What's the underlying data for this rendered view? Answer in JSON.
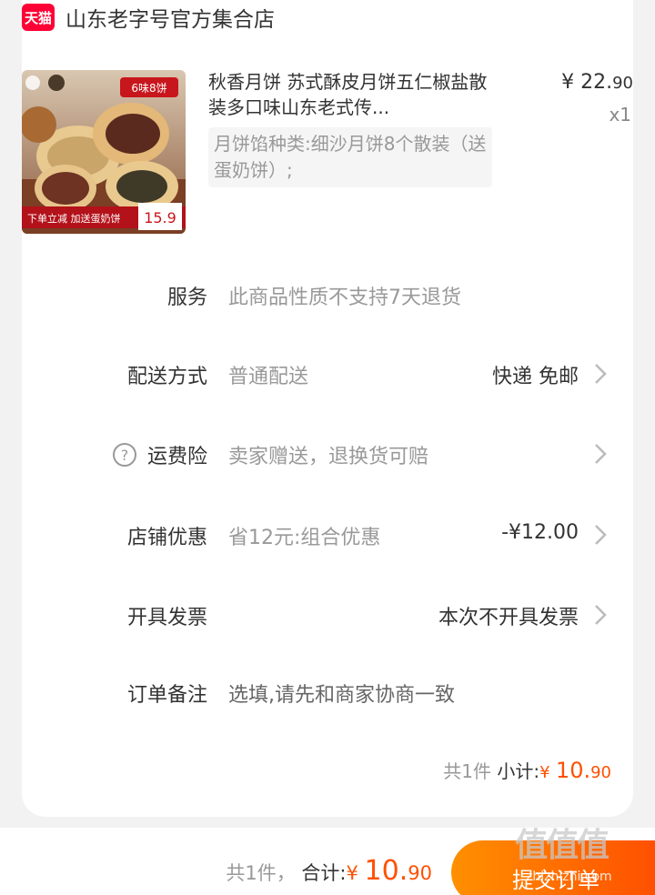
{
  "shop": {
    "badge": "天猫",
    "name": "山东老字号官方集合店"
  },
  "product": {
    "title": "秋香月饼 苏式酥皮月饼五仁椒盐散装多口味山东老式传...",
    "price_symbol": "¥",
    "price_int": "22.",
    "price_dec": "90",
    "qty": "x1",
    "sku": "月饼馅种类:细沙月饼8个散装（送蛋奶饼）;",
    "image": {
      "tag": "6味8饼",
      "promo": "下单立减 加送蛋奶饼",
      "promo_price": "15.9"
    }
  },
  "rows": {
    "service": {
      "label": "服务",
      "value": "此商品性质不支持7天退货"
    },
    "delivery": {
      "label": "配送方式",
      "value": "普通配送",
      "right": "快递 免邮"
    },
    "insurance": {
      "label": "运费险",
      "value": "卖家赠送，退换货可赔"
    },
    "discount": {
      "label": "店铺优惠",
      "value": "省12元:组合优惠",
      "right": "-¥12.00"
    },
    "invoice": {
      "label": "开具发票",
      "right": "本次不开具发票"
    },
    "note": {
      "label": "订单备注",
      "placeholder": "选填,请先和商家协商一致"
    }
  },
  "subtotal": {
    "count": "共1件",
    "label": "小计:",
    "symbol": "¥",
    "int": "10.",
    "dec": "90"
  },
  "bottom": {
    "count": "共1件，",
    "label": "合计:",
    "symbol": "¥",
    "int": "10.",
    "dec": "90",
    "submit": "提交订单"
  },
  "watermark": {
    "text": "值值值",
    "sub": "zhizhizhi.com"
  },
  "colors": {
    "accent": "#ff5000",
    "tmall": "#ff0036"
  }
}
